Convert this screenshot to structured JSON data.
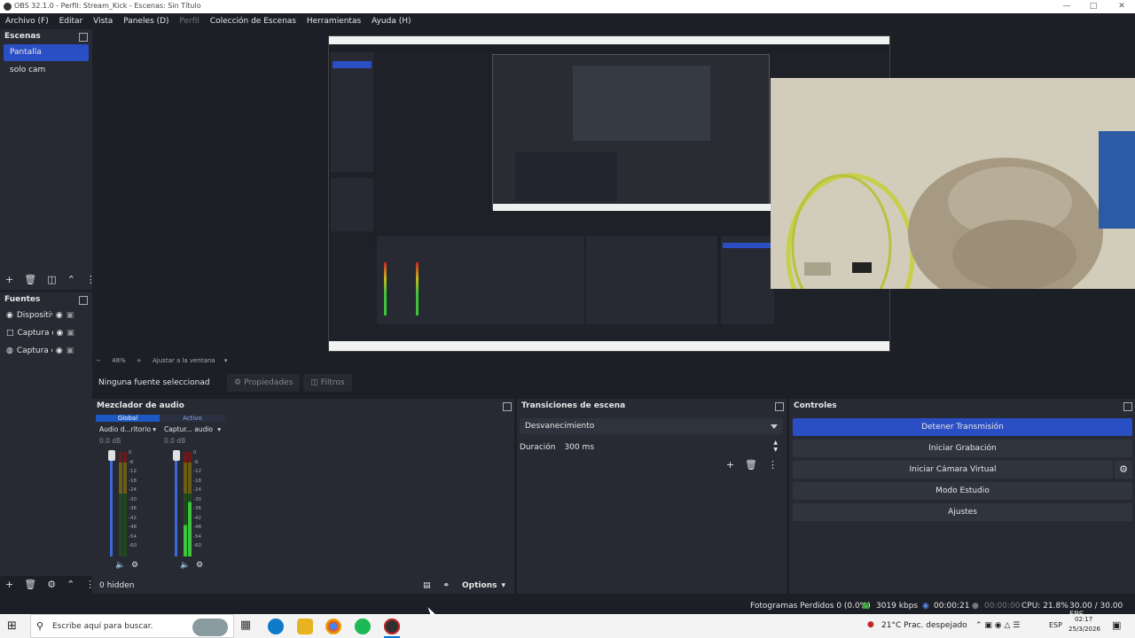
{
  "window": {
    "title": "OBS 32.1.0 - Perfil: Stream_Kick - Escenas: Sin Título",
    "controls": [
      "minimize",
      "maximize",
      "close"
    ]
  },
  "menu": {
    "items": [
      "Archivo (F)",
      "Editar",
      "Vista",
      "Paneles (D)",
      "Perfil",
      "Colección de Escenas",
      "Herramientas",
      "Ayuda (H)"
    ]
  },
  "scenes": {
    "title": "Escenas",
    "items": [
      "Pantalla",
      "solo cam"
    ],
    "active_index": 0
  },
  "sources": {
    "title": "Fuentes",
    "items": [
      "Dispositiv",
      "Captura d",
      "Captura d"
    ],
    "icons": [
      "camera-icon",
      "monitor-icon",
      "microphone-icon"
    ]
  },
  "preview": {
    "zoom": "48%",
    "fit_label": "Ajustar a la ventana"
  },
  "context_bar": {
    "no_source": "Ninguna fuente seleccionad",
    "properties": "Propiedades",
    "filters": "Filtros"
  },
  "audio_mixer": {
    "title": "Mezclador de audio",
    "tabs": [
      "Global",
      "Activo"
    ],
    "channels": [
      {
        "name": "Audio d...ritorio",
        "db": "0.0 dB",
        "level": 0.0
      },
      {
        "name": "Captur... audio",
        "db": "0.0 dB",
        "level": 0.3
      }
    ],
    "scale": [
      "0",
      "-6",
      "-12",
      "-18",
      "-24",
      "-30",
      "-36",
      "-42",
      "-48",
      "-54",
      "-60"
    ],
    "hidden": "0 hidden",
    "options": "Options"
  },
  "transitions": {
    "title": "Transiciones de escena",
    "selected": "Desvanecimiento",
    "duration_label": "Duración",
    "duration_value": "300 ms"
  },
  "controls": {
    "title": "Controles",
    "stop_stream": "Detener Transmisión",
    "start_recording": "Iniciar Grabación",
    "virtual_camera": "Iniciar Cámara Virtual",
    "studio_mode": "Modo Estudio",
    "settings": "Ajustes"
  },
  "status": {
    "dropped_frames": "Fotogramas Perdidos 0 (0.0%)",
    "bitrate": "3019 kbps",
    "stream_time": "00:00:21",
    "rec_time": "00:00:00",
    "cpu": "CPU: 21.8%",
    "fps": "30.00 / 30.00 FPS"
  },
  "taskbar": {
    "search_placeholder": "Escribe aquí para buscar.",
    "weather": "21°C  Prac. despejado",
    "language": "ESP",
    "time": "02:17",
    "date": "25/3/2026"
  },
  "colors": {
    "accent": "#2a4fc4",
    "panel_bg": "#272a33",
    "app_bg": "#1d1f26",
    "meter_green": "#3cc43c",
    "meter_yellow": "#c8b41e",
    "meter_red": "#c42626"
  }
}
